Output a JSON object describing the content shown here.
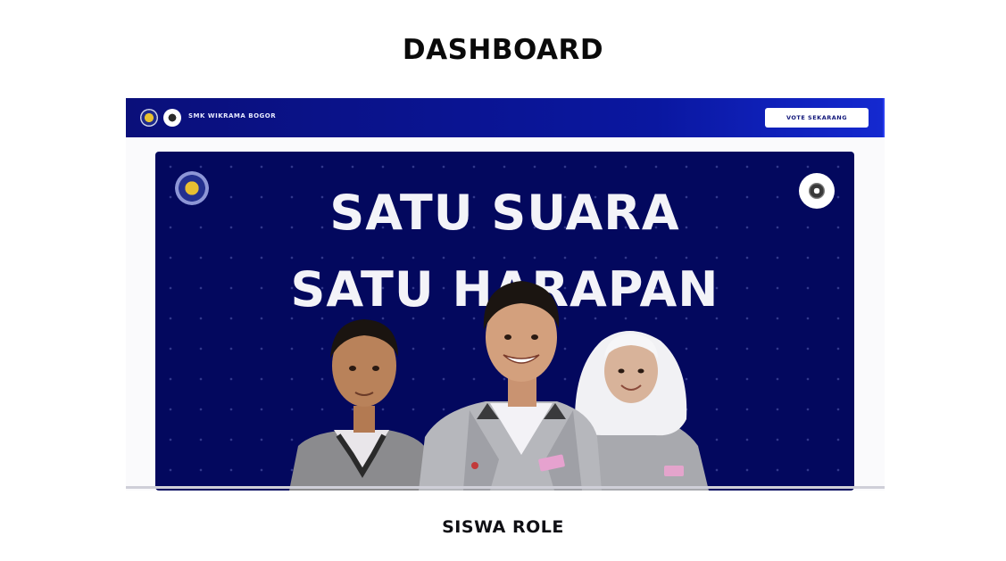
{
  "page": {
    "title": "DASHBOARD",
    "caption": "SISWA ROLE"
  },
  "preview": {
    "navbar": {
      "brand": "SMK WIKRAMA BOGOR",
      "vote_button": "VOTE SEKARANG"
    },
    "hero": {
      "headline_line1": "SATU SUARA",
      "headline_line2": "SATU HARAPAN"
    }
  },
  "colors": {
    "navbar": "#0a17a0",
    "hero_background": "#03085e",
    "headline": "#f3f3f8",
    "text": "#0a0a0a"
  }
}
